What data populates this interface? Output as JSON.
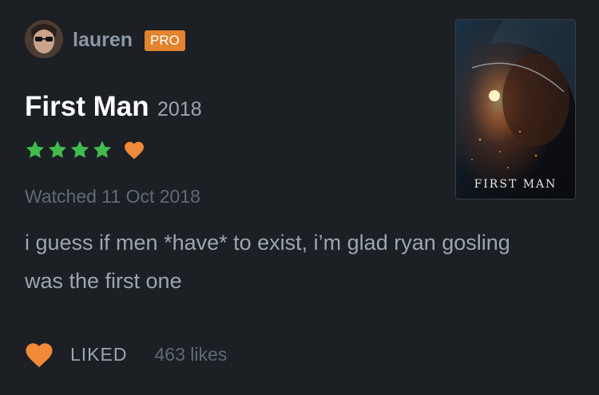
{
  "user": {
    "name": "lauren",
    "badge": "PRO"
  },
  "film": {
    "title": "First Man",
    "year": "2018",
    "poster_title": "FIRST MAN"
  },
  "rating": {
    "stars": 4,
    "max": 5,
    "star_color": "#40bc4e",
    "liked_heart": true,
    "heart_color": "#f08a38"
  },
  "watched": "Watched 11 Oct 2018",
  "review": "i guess if men *have* to exist, i’m glad ryan gosling was the first one",
  "footer": {
    "liked_label": "LIKED",
    "likes": "463 likes"
  },
  "icons": {
    "star": "star-icon",
    "heart": "heart-icon"
  }
}
